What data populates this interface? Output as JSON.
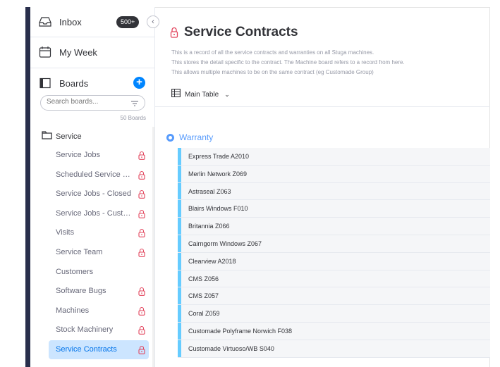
{
  "sidebar": {
    "inbox_label": "Inbox",
    "inbox_badge": "500+",
    "my_week_label": "My Week",
    "boards_label": "Boards",
    "search_placeholder": "Search boards...",
    "boards_count": "50 Boards",
    "folder_name": "Service",
    "boards": [
      {
        "label": "Service Jobs",
        "locked": true
      },
      {
        "label": "Scheduled Service Visits",
        "locked": true
      },
      {
        "label": "Service Jobs - Closed",
        "locked": true
      },
      {
        "label": "Service Jobs - Custom...",
        "locked": true
      },
      {
        "label": "Visits",
        "locked": true
      },
      {
        "label": "Service Team",
        "locked": true
      },
      {
        "label": "Customers",
        "locked": false
      },
      {
        "label": "Software Bugs",
        "locked": true
      },
      {
        "label": "Machines",
        "locked": true
      },
      {
        "label": "Stock Machinery",
        "locked": true
      },
      {
        "label": "Service Contracts",
        "locked": true,
        "active": true
      }
    ],
    "icons": [
      "inbox-icon",
      "calendar-icon",
      "board-icon",
      "plus-icon",
      "filter-icon",
      "folder-icon",
      "lock-icon",
      "chevron-left-icon"
    ]
  },
  "main": {
    "title": "Service Contracts",
    "description": [
      "This is a record of all the service contracts and warranties on all Stuga machines.",
      "This stores the detail specific to the contract. The Machine board refers to a record from here.",
      "This allows multiple machines to be on the same contract (eg Customade Group)"
    ],
    "view_label": "Main Table",
    "group": {
      "name": "Warranty",
      "color": "#579bfc",
      "row_color": "#66ccff",
      "items": [
        "Express Trade A2010",
        "Merlin Network Z069",
        "Astraseal Z063",
        "Blairs Windows F010",
        "Britannia Z066",
        "Cairngorm Windows Z067",
        "Clearview A2018",
        "CMS Z056",
        "CMS Z057",
        "Coral Z059",
        "Customade Polyframe Norwich F038",
        "Customade Virtuoso/WB S040"
      ]
    }
  },
  "colors": {
    "accent": "#0085ff",
    "active_board_bg": "#cce5ff",
    "dark_bar": "#292f4c",
    "lock": "#e2445c"
  }
}
